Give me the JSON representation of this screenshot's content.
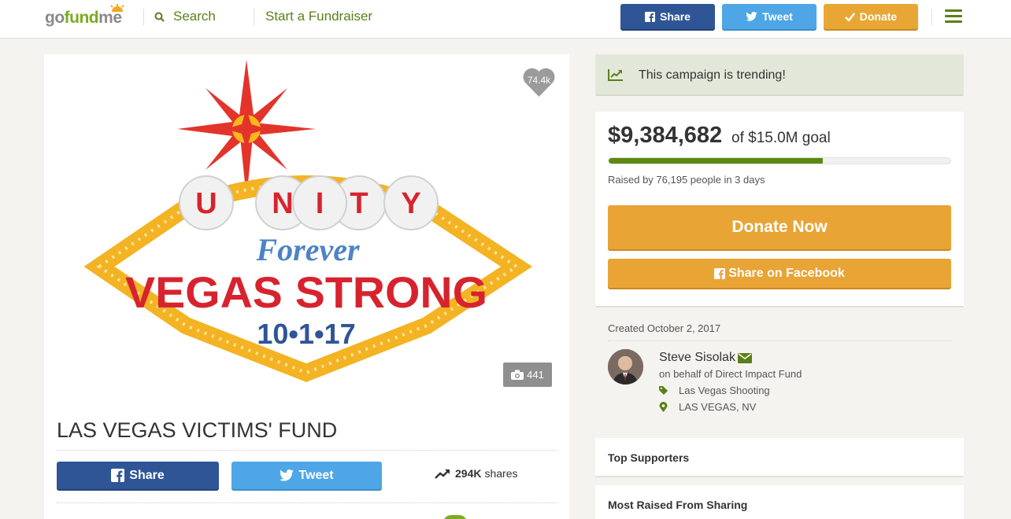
{
  "header": {
    "logo": {
      "go": "go",
      "fund": "fund",
      "me": "me"
    },
    "search_label": "Search",
    "start_label": "Start a Fundraiser",
    "share_label": "Share",
    "tweet_label": "Tweet",
    "donate_label": "Donate"
  },
  "campaign": {
    "hero_heart_count": "74.4k",
    "photo_count": "441",
    "title": "LAS VEGAS VICTIMS' FUND",
    "share_label": "Share",
    "tweet_label": "Tweet",
    "shares_count": "294K",
    "shares_label": "shares"
  },
  "sidebar": {
    "trend_text": "This campaign is trending!",
    "raised_amount": "$9,384,682",
    "goal_text": "of $15.0M goal",
    "progress_fraction": 0.626,
    "raised_by": "Raised by 76,195 people in 3 days",
    "donate_now_label": "Donate Now",
    "share_facebook_label": "Share on Facebook",
    "created": "Created October 2, 2017",
    "organizer_name": "Steve Sisolak",
    "on_behalf": "on behalf of Direct Impact Fund",
    "category": "Las Vegas Shooting",
    "location": "LAS VEGAS, NV",
    "top_supporters_label": "Top Supporters",
    "most_raised_label": "Most Raised From Sharing"
  },
  "colors": {
    "brand_green": "#7bab1e",
    "facebook_blue": "#2f5597",
    "twitter_blue": "#4ea6e6",
    "donate_orange": "#e9a436",
    "progress_green": "#5b8a13"
  },
  "icons": [
    "search-icon",
    "facebook-icon",
    "twitter-icon",
    "check-icon",
    "menu-icon",
    "heart-icon",
    "camera-icon",
    "trending-icon",
    "envelope-icon",
    "tag-icon",
    "map-pin-icon"
  ]
}
